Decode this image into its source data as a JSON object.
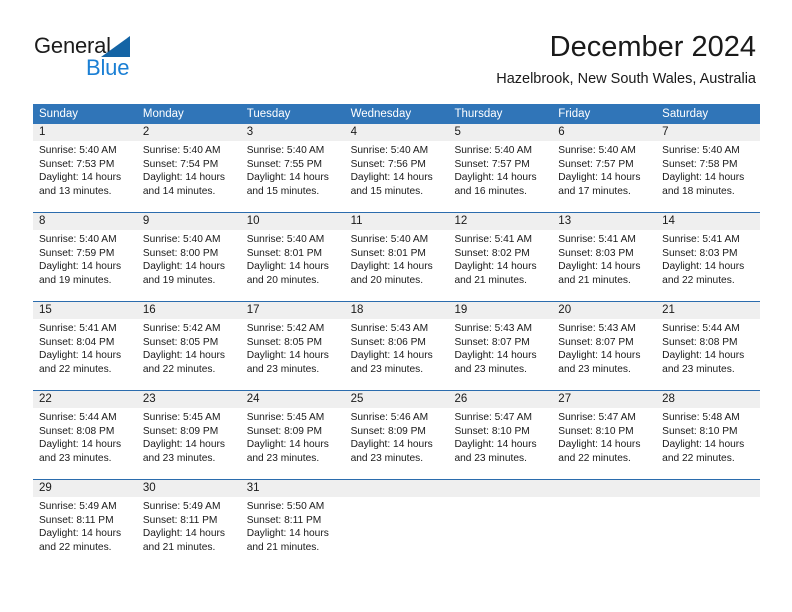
{
  "branding": {
    "logo_text_primary": "General",
    "logo_text_secondary": "Blue",
    "logo_triangle_color": "#1464a5",
    "logo_blue_color": "#1b7fd4"
  },
  "header": {
    "month_title": "December 2024",
    "location": "Hazelbrook, New South Wales, Australia"
  },
  "theme": {
    "header_blue": "#3075b8",
    "week_divider_blue": "#2b6cad",
    "day_number_band": "#efefef"
  },
  "calendar": {
    "weekday_headers": [
      "Sunday",
      "Monday",
      "Tuesday",
      "Wednesday",
      "Thursday",
      "Friday",
      "Saturday"
    ],
    "weeks": [
      [
        {
          "day": "1",
          "sunrise": "Sunrise: 5:40 AM",
          "sunset": "Sunset: 7:53 PM",
          "daylight_line1": "Daylight: 14 hours",
          "daylight_line2": "and 13 minutes."
        },
        {
          "day": "2",
          "sunrise": "Sunrise: 5:40 AM",
          "sunset": "Sunset: 7:54 PM",
          "daylight_line1": "Daylight: 14 hours",
          "daylight_line2": "and 14 minutes."
        },
        {
          "day": "3",
          "sunrise": "Sunrise: 5:40 AM",
          "sunset": "Sunset: 7:55 PM",
          "daylight_line1": "Daylight: 14 hours",
          "daylight_line2": "and 15 minutes."
        },
        {
          "day": "4",
          "sunrise": "Sunrise: 5:40 AM",
          "sunset": "Sunset: 7:56 PM",
          "daylight_line1": "Daylight: 14 hours",
          "daylight_line2": "and 15 minutes."
        },
        {
          "day": "5",
          "sunrise": "Sunrise: 5:40 AM",
          "sunset": "Sunset: 7:57 PM",
          "daylight_line1": "Daylight: 14 hours",
          "daylight_line2": "and 16 minutes."
        },
        {
          "day": "6",
          "sunrise": "Sunrise: 5:40 AM",
          "sunset": "Sunset: 7:57 PM",
          "daylight_line1": "Daylight: 14 hours",
          "daylight_line2": "and 17 minutes."
        },
        {
          "day": "7",
          "sunrise": "Sunrise: 5:40 AM",
          "sunset": "Sunset: 7:58 PM",
          "daylight_line1": "Daylight: 14 hours",
          "daylight_line2": "and 18 minutes."
        }
      ],
      [
        {
          "day": "8",
          "sunrise": "Sunrise: 5:40 AM",
          "sunset": "Sunset: 7:59 PM",
          "daylight_line1": "Daylight: 14 hours",
          "daylight_line2": "and 19 minutes."
        },
        {
          "day": "9",
          "sunrise": "Sunrise: 5:40 AM",
          "sunset": "Sunset: 8:00 PM",
          "daylight_line1": "Daylight: 14 hours",
          "daylight_line2": "and 19 minutes."
        },
        {
          "day": "10",
          "sunrise": "Sunrise: 5:40 AM",
          "sunset": "Sunset: 8:01 PM",
          "daylight_line1": "Daylight: 14 hours",
          "daylight_line2": "and 20 minutes."
        },
        {
          "day": "11",
          "sunrise": "Sunrise: 5:40 AM",
          "sunset": "Sunset: 8:01 PM",
          "daylight_line1": "Daylight: 14 hours",
          "daylight_line2": "and 20 minutes."
        },
        {
          "day": "12",
          "sunrise": "Sunrise: 5:41 AM",
          "sunset": "Sunset: 8:02 PM",
          "daylight_line1": "Daylight: 14 hours",
          "daylight_line2": "and 21 minutes."
        },
        {
          "day": "13",
          "sunrise": "Sunrise: 5:41 AM",
          "sunset": "Sunset: 8:03 PM",
          "daylight_line1": "Daylight: 14 hours",
          "daylight_line2": "and 21 minutes."
        },
        {
          "day": "14",
          "sunrise": "Sunrise: 5:41 AM",
          "sunset": "Sunset: 8:03 PM",
          "daylight_line1": "Daylight: 14 hours",
          "daylight_line2": "and 22 minutes."
        }
      ],
      [
        {
          "day": "15",
          "sunrise": "Sunrise: 5:41 AM",
          "sunset": "Sunset: 8:04 PM",
          "daylight_line1": "Daylight: 14 hours",
          "daylight_line2": "and 22 minutes."
        },
        {
          "day": "16",
          "sunrise": "Sunrise: 5:42 AM",
          "sunset": "Sunset: 8:05 PM",
          "daylight_line1": "Daylight: 14 hours",
          "daylight_line2": "and 22 minutes."
        },
        {
          "day": "17",
          "sunrise": "Sunrise: 5:42 AM",
          "sunset": "Sunset: 8:05 PM",
          "daylight_line1": "Daylight: 14 hours",
          "daylight_line2": "and 23 minutes."
        },
        {
          "day": "18",
          "sunrise": "Sunrise: 5:43 AM",
          "sunset": "Sunset: 8:06 PM",
          "daylight_line1": "Daylight: 14 hours",
          "daylight_line2": "and 23 minutes."
        },
        {
          "day": "19",
          "sunrise": "Sunrise: 5:43 AM",
          "sunset": "Sunset: 8:07 PM",
          "daylight_line1": "Daylight: 14 hours",
          "daylight_line2": "and 23 minutes."
        },
        {
          "day": "20",
          "sunrise": "Sunrise: 5:43 AM",
          "sunset": "Sunset: 8:07 PM",
          "daylight_line1": "Daylight: 14 hours",
          "daylight_line2": "and 23 minutes."
        },
        {
          "day": "21",
          "sunrise": "Sunrise: 5:44 AM",
          "sunset": "Sunset: 8:08 PM",
          "daylight_line1": "Daylight: 14 hours",
          "daylight_line2": "and 23 minutes."
        }
      ],
      [
        {
          "day": "22",
          "sunrise": "Sunrise: 5:44 AM",
          "sunset": "Sunset: 8:08 PM",
          "daylight_line1": "Daylight: 14 hours",
          "daylight_line2": "and 23 minutes."
        },
        {
          "day": "23",
          "sunrise": "Sunrise: 5:45 AM",
          "sunset": "Sunset: 8:09 PM",
          "daylight_line1": "Daylight: 14 hours",
          "daylight_line2": "and 23 minutes."
        },
        {
          "day": "24",
          "sunrise": "Sunrise: 5:45 AM",
          "sunset": "Sunset: 8:09 PM",
          "daylight_line1": "Daylight: 14 hours",
          "daylight_line2": "and 23 minutes."
        },
        {
          "day": "25",
          "sunrise": "Sunrise: 5:46 AM",
          "sunset": "Sunset: 8:09 PM",
          "daylight_line1": "Daylight: 14 hours",
          "daylight_line2": "and 23 minutes."
        },
        {
          "day": "26",
          "sunrise": "Sunrise: 5:47 AM",
          "sunset": "Sunset: 8:10 PM",
          "daylight_line1": "Daylight: 14 hours",
          "daylight_line2": "and 23 minutes."
        },
        {
          "day": "27",
          "sunrise": "Sunrise: 5:47 AM",
          "sunset": "Sunset: 8:10 PM",
          "daylight_line1": "Daylight: 14 hours",
          "daylight_line2": "and 22 minutes."
        },
        {
          "day": "28",
          "sunrise": "Sunrise: 5:48 AM",
          "sunset": "Sunset: 8:10 PM",
          "daylight_line1": "Daylight: 14 hours",
          "daylight_line2": "and 22 minutes."
        }
      ],
      [
        {
          "day": "29",
          "sunrise": "Sunrise: 5:49 AM",
          "sunset": "Sunset: 8:11 PM",
          "daylight_line1": "Daylight: 14 hours",
          "daylight_line2": "and 22 minutes."
        },
        {
          "day": "30",
          "sunrise": "Sunrise: 5:49 AM",
          "sunset": "Sunset: 8:11 PM",
          "daylight_line1": "Daylight: 14 hours",
          "daylight_line2": "and 21 minutes."
        },
        {
          "day": "31",
          "sunrise": "Sunrise: 5:50 AM",
          "sunset": "Sunset: 8:11 PM",
          "daylight_line1": "Daylight: 14 hours",
          "daylight_line2": "and 21 minutes."
        },
        {
          "day": "",
          "sunrise": "",
          "sunset": "",
          "daylight_line1": "",
          "daylight_line2": ""
        },
        {
          "day": "",
          "sunrise": "",
          "sunset": "",
          "daylight_line1": "",
          "daylight_line2": ""
        },
        {
          "day": "",
          "sunrise": "",
          "sunset": "",
          "daylight_line1": "",
          "daylight_line2": ""
        },
        {
          "day": "",
          "sunrise": "",
          "sunset": "",
          "daylight_line1": "",
          "daylight_line2": ""
        }
      ]
    ]
  }
}
